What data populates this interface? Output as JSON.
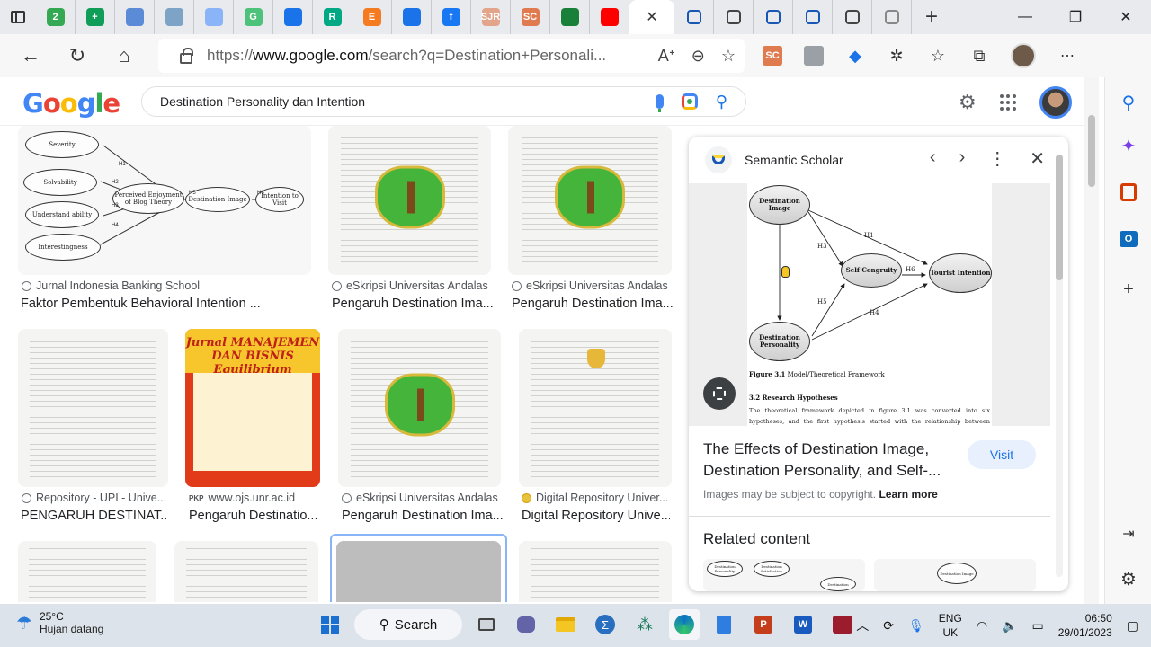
{
  "browser": {
    "tabs": [
      {
        "icon": "tab-badge-icon",
        "text": "2",
        "color": "#34a853"
      },
      {
        "icon": "cross-icon",
        "text": "+",
        "color": "#0f9d58"
      },
      {
        "icon": "outlook-icon",
        "text": "",
        "color": "#5b8bd6"
      },
      {
        "icon": "sheet-icon",
        "text": "",
        "color": "#7da3c6"
      },
      {
        "icon": "translate-icon",
        "text": "",
        "color": "#8ab4f8"
      },
      {
        "icon": "grammarly-icon",
        "text": "G",
        "color": "#4cc27a"
      },
      {
        "icon": "cap-icon",
        "text": "",
        "color": "#1a73e8"
      },
      {
        "icon": "researchgate-icon",
        "text": "R",
        "color": "#00a984"
      },
      {
        "icon": "elsevier-icon",
        "text": "E",
        "color": "#f47b20"
      },
      {
        "icon": "cap-icon",
        "text": "",
        "color": "#1a73e8"
      },
      {
        "icon": "facebook-icon",
        "text": "f",
        "color": "#1877f2"
      },
      {
        "icon": "sjr-icon",
        "text": "SJR",
        "color": "#e2a48a"
      },
      {
        "icon": "sc-icon",
        "text": "SC",
        "color": "#e07a4f"
      },
      {
        "icon": "classroom-icon",
        "text": "",
        "color": "#188038"
      },
      {
        "icon": "youtube-icon",
        "text": "",
        "color": "#ff0000"
      }
    ],
    "active_close": "✕",
    "after_tabs": [
      {
        "icon": "semantic-scholar-icon",
        "color": "#1857b6"
      },
      {
        "icon": "unlock-icon",
        "color": "#444"
      },
      {
        "icon": "semantic-scholar-icon",
        "color": "#1857b6"
      },
      {
        "icon": "semantic-scholar-icon",
        "color": "#1857b6"
      },
      {
        "icon": "page-icon",
        "color": "#444"
      },
      {
        "icon": "page-lock-icon",
        "color": "#888"
      }
    ],
    "new_tab": "+",
    "url_prefix": "https://",
    "url_host": "www.google.com",
    "url_rest": "/search?q=Destination+Personali...",
    "read_aloud": "A",
    "ext_sc": "SC"
  },
  "google": {
    "logo_letters": [
      {
        "ch": "G",
        "color": "#4285f4"
      },
      {
        "ch": "o",
        "color": "#ea4335"
      },
      {
        "ch": "o",
        "color": "#fbbc05"
      },
      {
        "ch": "g",
        "color": "#4285f4"
      },
      {
        "ch": "l",
        "color": "#34a853"
      },
      {
        "ch": "e",
        "color": "#ea4335"
      }
    ],
    "query": "Destination Personality dan Intention"
  },
  "results": {
    "row1": [
      {
        "source": "Jurnal Indonesia Banking School",
        "title": "Faktor Pembentuk Behavioral Intention ..."
      },
      {
        "source": "eSkripsi Universitas Andalas",
        "title": "Pengaruh Destination Ima..."
      },
      {
        "source": "eSkripsi Universitas Andalas",
        "title": "Pengaruh Destination Ima..."
      }
    ],
    "row2": [
      {
        "source": "Repository - UPI - Unive...",
        "title": "PENGARUH DESTINAT..."
      },
      {
        "source": "www.ojs.unr.ac.id",
        "prefix": "PKP",
        "title": "Pengaruh Destinatio..."
      },
      {
        "source": "eSkripsi Universitas Andalas",
        "title": "Pengaruh Destination Ima..."
      },
      {
        "source": "Digital Repository Univer...",
        "title": "Digital Repository Unive..."
      }
    ],
    "diagram1_nodes": [
      "Severity",
      "Solvability",
      "Understand ability",
      "Interestingness",
      "Perceived Enjoyment of Blog Theory",
      "Destination Image",
      "Intention to Visit"
    ],
    "diagram1_labels": [
      "H1",
      "H2",
      "H3",
      "H4",
      "H5",
      "H6"
    ],
    "poster_title": "Jurnal MANAJEMEN DAN BISNIS Equilibrium"
  },
  "preview": {
    "source": "Semantic Scholar",
    "nodes": {
      "image": "Destination Image",
      "congruity": "Self Congruity",
      "tourist": "Tourist Intention",
      "personality": "Destination Personality"
    },
    "hyp": {
      "h1": "H1",
      "h3": "H3",
      "h4": "H4",
      "h5": "H5",
      "h6": "H6"
    },
    "caption_bold": "Figure 3.1",
    "caption": " Model/Theoretical Framework",
    "section": "3.2 Research Hypotheses",
    "body": "The theoretical framework depicted in figure 3.1 was converted into six hypotheses, and the first hypothesis started with the relationship between destination",
    "title": "The Effects of Destination Image, Destination Personality, and Self-...",
    "visit": "Visit",
    "copyright": "Images may be subject to copyright.",
    "learn_more": "Learn more",
    "related": "Related content",
    "related_nodes_1": [
      "Destination Personality",
      "Destination Satisfaction",
      "Destination"
    ],
    "related_nodes_2": [
      "Destination Image"
    ]
  },
  "taskbar": {
    "temp": "25°C",
    "weather": "Hujan datang",
    "search": "Search",
    "lang1": "ENG",
    "lang2": "UK",
    "time": "06:50",
    "date": "29/01/2023"
  }
}
